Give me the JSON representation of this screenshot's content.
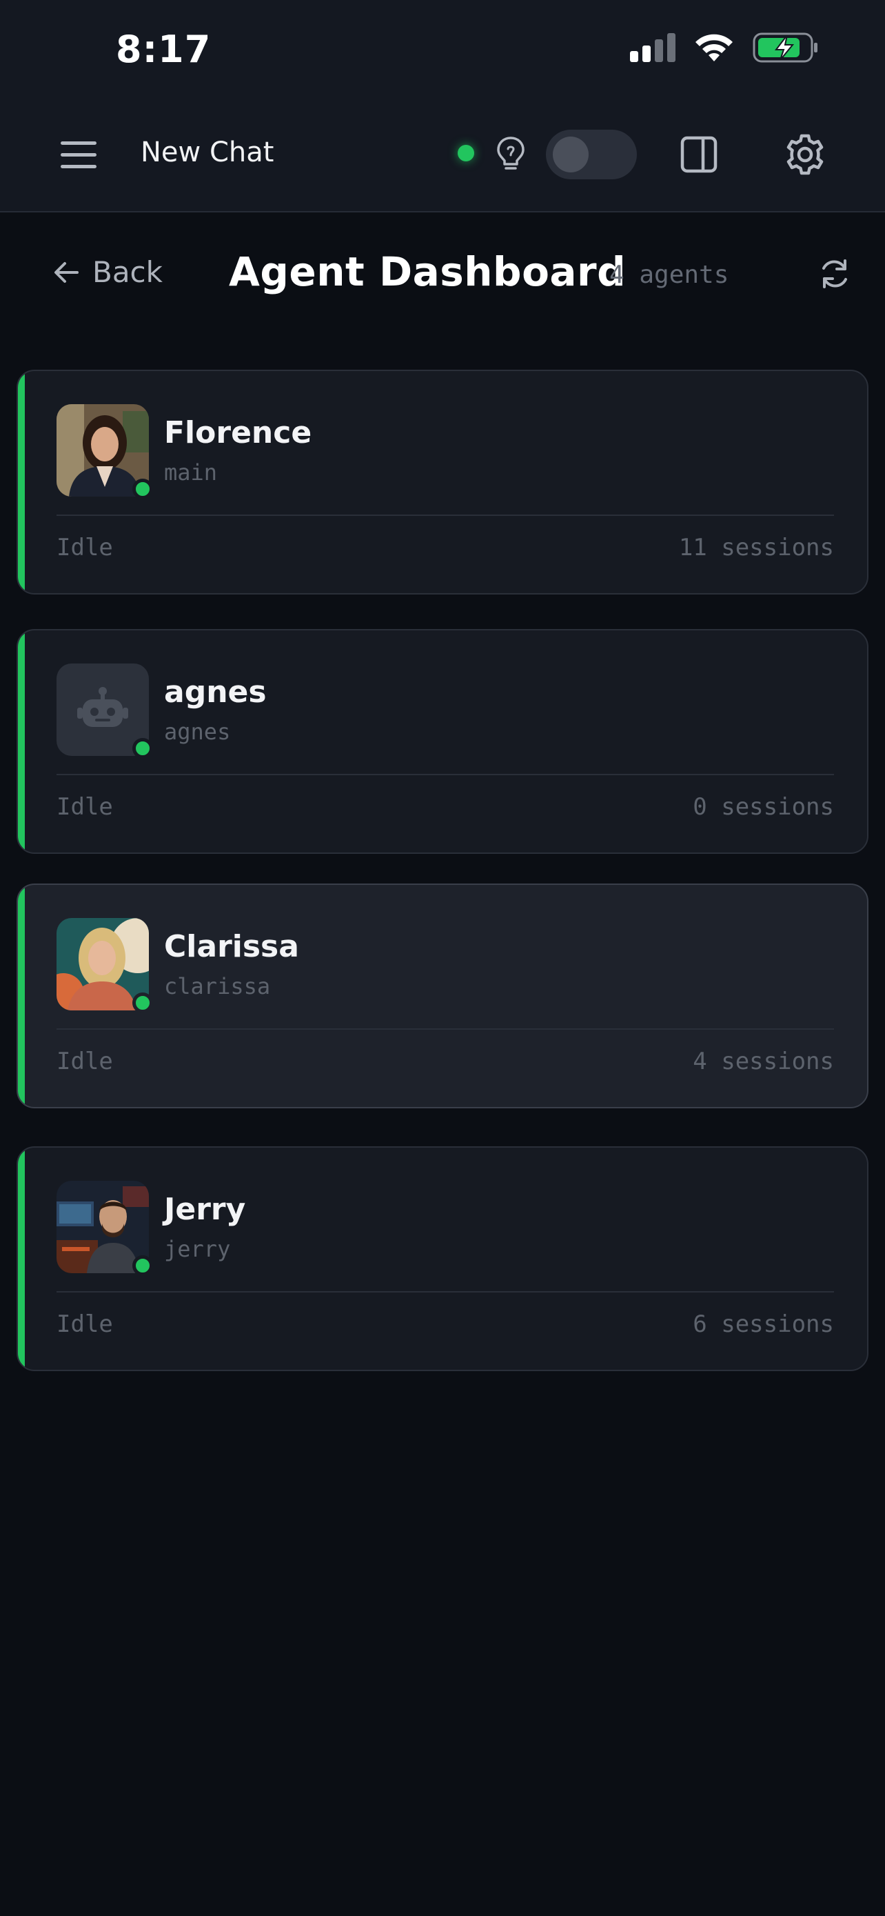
{
  "status_bar": {
    "time": "8:17",
    "icons": [
      "signal-icon",
      "wifi-icon",
      "battery-charging-icon"
    ]
  },
  "appbar": {
    "title": "New Chat",
    "connection_color": "#22c55e",
    "toggle_on": false
  },
  "header": {
    "back_label": "Back",
    "title": "Agent Dashboard",
    "count": "4 agents"
  },
  "colors": {
    "accent": "#22c55e",
    "background": "#0b0e14",
    "card": "#161a22"
  },
  "agents": [
    {
      "name": "Florence",
      "id": "main",
      "status": "Idle",
      "sessions": "11 sessions",
      "avatar": "photo-woman-dark-hair"
    },
    {
      "name": "agnes",
      "id": "agnes",
      "status": "Idle",
      "sessions": "0 sessions",
      "avatar": "robot-placeholder-icon"
    },
    {
      "name": "Clarissa",
      "id": "clarissa",
      "status": "Idle",
      "sessions": "4 sessions",
      "avatar": "photo-woman-blonde"
    },
    {
      "name": "Jerry",
      "id": "jerry",
      "status": "Idle",
      "sessions": "6 sessions",
      "avatar": "photo-man-studio"
    }
  ]
}
